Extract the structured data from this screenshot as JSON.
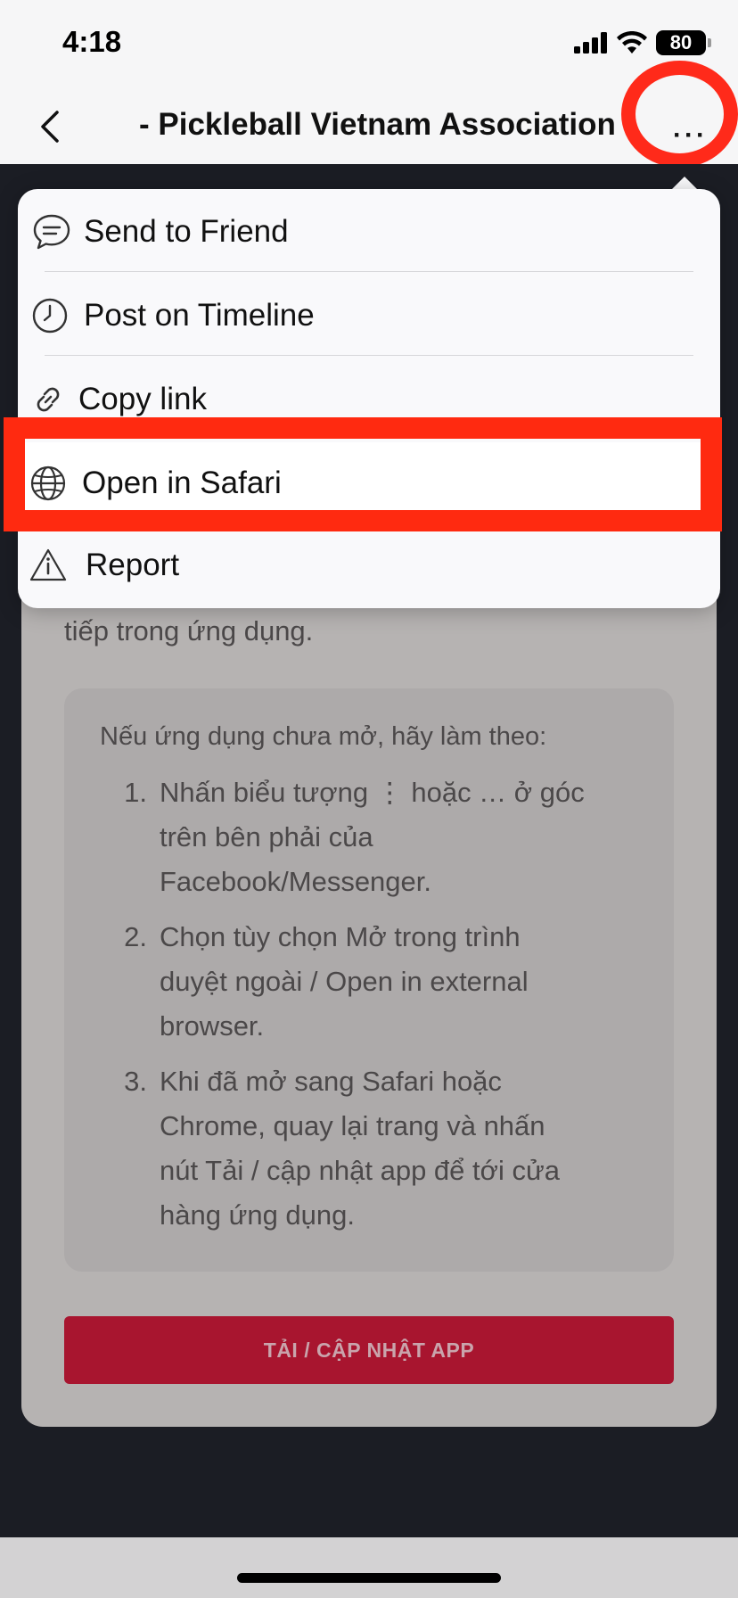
{
  "status_bar": {
    "time": "4:18",
    "battery": "80"
  },
  "nav": {
    "title": "- Pickleball Vietnam Association"
  },
  "menu": {
    "items": [
      {
        "label": "Send to Friend",
        "icon": "chat-bubble-icon"
      },
      {
        "label": "Post on Timeline",
        "icon": "clock-icon"
      },
      {
        "label": "Copy link",
        "icon": "link-icon"
      },
      {
        "label": "Open in Safari",
        "icon": "globe-icon"
      },
      {
        "label": "Report",
        "icon": "warning-icon"
      }
    ]
  },
  "page": {
    "intro_tail": "tiếp trong ứng dụng.",
    "instructions_heading": "Nếu ứng dụng chưa mở, hãy làm theo:",
    "steps": [
      {
        "num": "1.",
        "lines": [
          "Nhấn biểu tượng ⋮ hoặc … ở góc",
          "trên bên phải của",
          "Facebook/Messenger."
        ]
      },
      {
        "num": "2.",
        "lines": [
          "Chọn tùy chọn Mở trong trình",
          "duyệt ngoài / Open in external",
          "browser."
        ]
      },
      {
        "num": "3.",
        "lines": [
          "Khi đã mở sang Safari hoặc",
          "Chrome, quay lại trang và nhấn",
          "nút Tải / cập nhật app để tới cửa",
          "hàng ứng dụng."
        ]
      }
    ],
    "download_button": "TẢI / CẬP NHẬT APP"
  },
  "colors": {
    "annotation_red": "#ff2a1a",
    "button_red": "#a8152f"
  }
}
